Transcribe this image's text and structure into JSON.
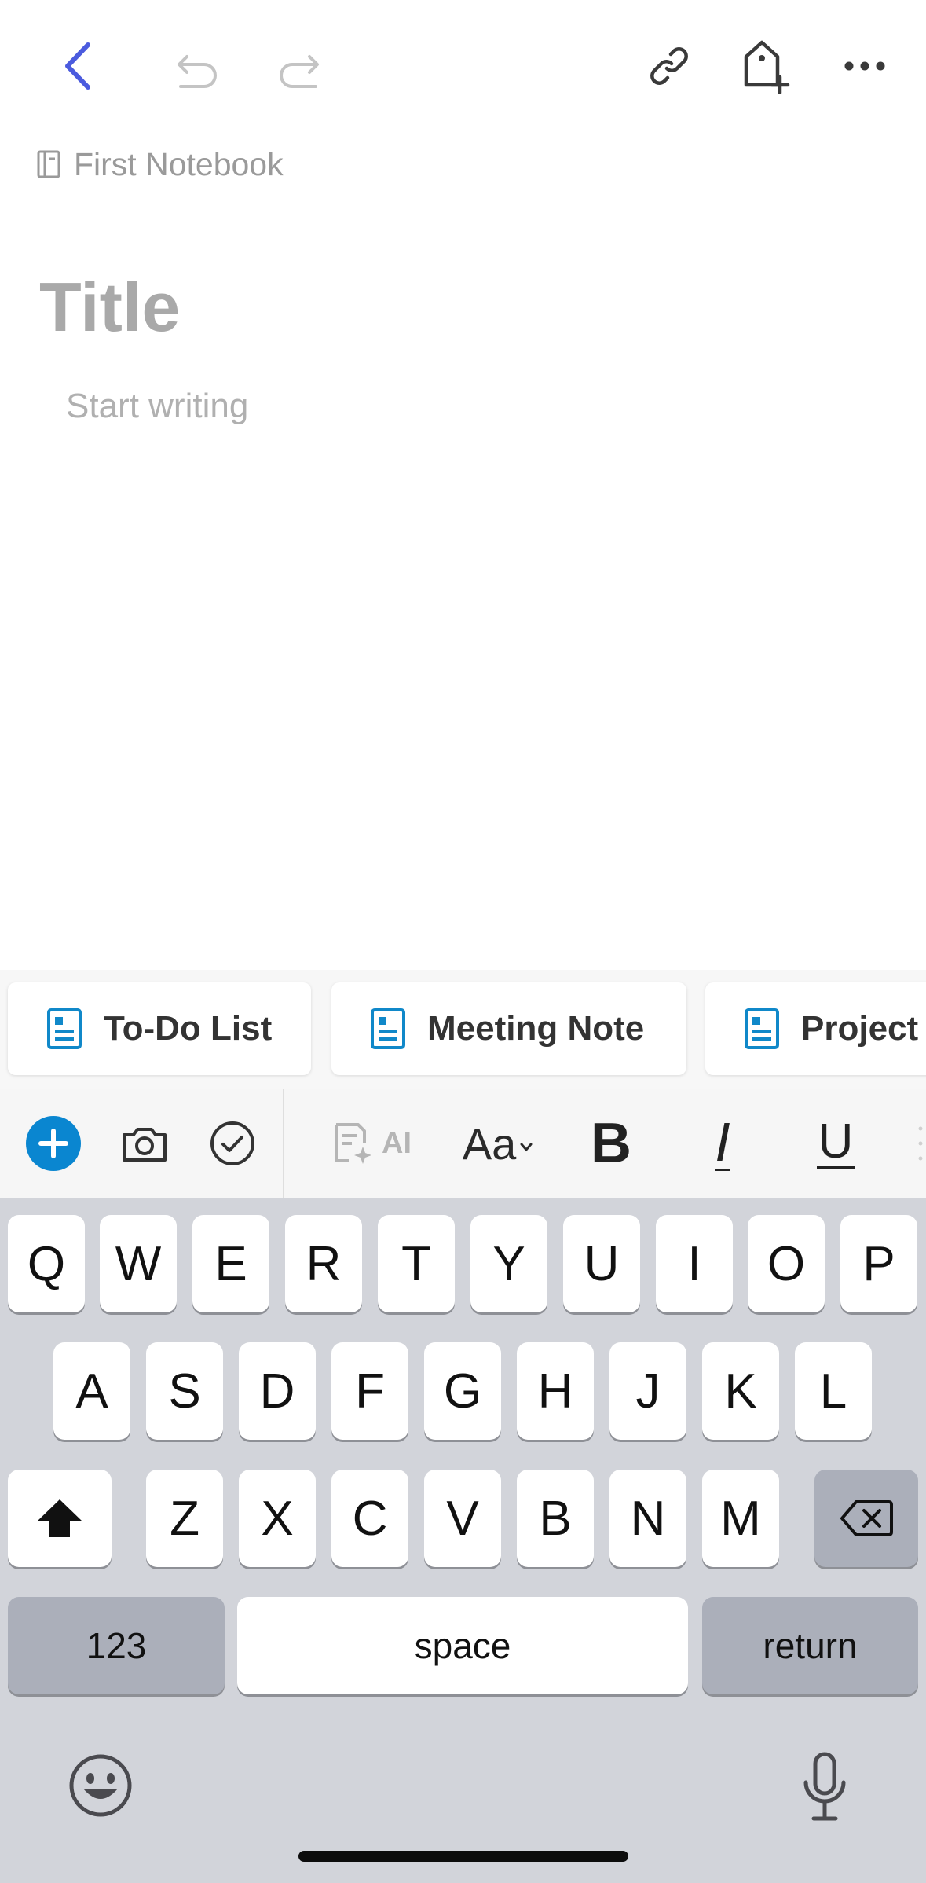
{
  "app": {
    "notebook_label": "First Notebook",
    "title_placeholder": "Title",
    "body_placeholder": "Start writing"
  },
  "topbar": {
    "icons": [
      "back-chevron-icon",
      "undo-icon",
      "redo-icon",
      "link-icon",
      "tag-add-icon",
      "more-icon"
    ],
    "accent_color": "#4b5bde"
  },
  "templates": [
    {
      "label": "To-Do List"
    },
    {
      "label": "Meeting Note"
    },
    {
      "label": "Project"
    }
  ],
  "toolbar": {
    "ai_label": "AI",
    "text_style_label": "Aa",
    "bold_label": "B",
    "italic_label": "I",
    "underline_label": "U",
    "add_color": "#0a86d0"
  },
  "keyboard": {
    "row1": [
      "Q",
      "W",
      "E",
      "R",
      "T",
      "Y",
      "U",
      "I",
      "O",
      "P"
    ],
    "row2": [
      "A",
      "S",
      "D",
      "F",
      "G",
      "H",
      "J",
      "K",
      "L"
    ],
    "row3": [
      "Z",
      "X",
      "C",
      "V",
      "B",
      "N",
      "M"
    ],
    "numbers_label": "123",
    "space_label": "space",
    "return_label": "return"
  }
}
